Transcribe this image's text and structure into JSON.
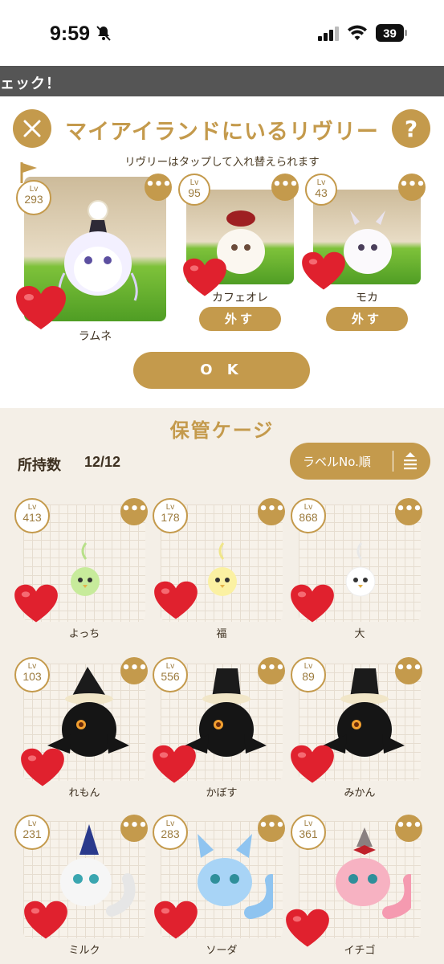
{
  "status_bar": {
    "time": "9:59",
    "battery": "39"
  },
  "banner": {
    "text": "ェック！"
  },
  "header": {
    "title": "マイアイランドにいるリヴリー",
    "subtitle": "リヴリーはタップして入れ替えられます",
    "close_icon": "close-icon",
    "help_label": "?"
  },
  "island": {
    "level_label": "Lv",
    "more_label": "•••",
    "remove_label": "外す",
    "pets": [
      {
        "level": "293",
        "name": "ラムネ"
      },
      {
        "level": "95",
        "name": "カフェオレ"
      },
      {
        "level": "43",
        "name": "モカ"
      }
    ],
    "ok_label": "O K"
  },
  "storage": {
    "title": "保管ケージ",
    "count_label": "所持数",
    "count_value": "12/12",
    "sort_label": "ラベルNo.順",
    "pets": [
      {
        "level": "413",
        "name": "よっち"
      },
      {
        "level": "178",
        "name": "福"
      },
      {
        "level": "868",
        "name": "大"
      },
      {
        "level": "103",
        "name": "れもん"
      },
      {
        "level": "556",
        "name": "かぼす"
      },
      {
        "level": "89",
        "name": "みかん"
      },
      {
        "level": "231",
        "name": "ミルク"
      },
      {
        "level": "283",
        "name": "ソーダ"
      },
      {
        "level": "361",
        "name": "イチゴ"
      }
    ]
  },
  "colors": {
    "accent": "#c49a4c",
    "heart": "#e0212e",
    "banner": "#555555"
  }
}
